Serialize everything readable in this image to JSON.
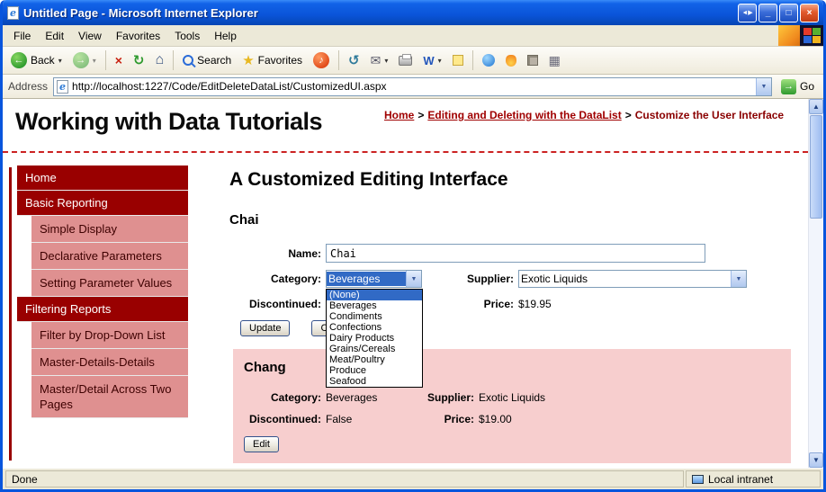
{
  "window": {
    "title": "Untitled Page - Microsoft Internet Explorer",
    "status": {
      "left": "Done",
      "right": "Local intranet"
    }
  },
  "menu_bar": {
    "items": [
      {
        "label": "File"
      },
      {
        "label": "Edit"
      },
      {
        "label": "View"
      },
      {
        "label": "Favorites"
      },
      {
        "label": "Tools"
      },
      {
        "label": "Help"
      }
    ]
  },
  "toolbar": {
    "back_label": "Back",
    "search_label": "Search",
    "favorites_label": "Favorites"
  },
  "address_bar": {
    "label": "Address",
    "url": "http://localhost:1227/Code/EditDeleteDataList/CustomizedUI.aspx",
    "go_label": "Go"
  },
  "header": {
    "title": "Working with Data Tutorials",
    "breadcrumb": {
      "home": "Home",
      "sep1": ">",
      "section": "Editing and Deleting with the DataList",
      "sep2": ">",
      "current": "Customize the User Interface"
    }
  },
  "sidebar": {
    "items": [
      {
        "label": "Home"
      },
      {
        "label": "Basic Reporting"
      },
      {
        "label": "Simple Display"
      },
      {
        "label": "Declarative Parameters"
      },
      {
        "label": "Setting Parameter Values"
      },
      {
        "label": "Filtering Reports"
      },
      {
        "label": "Filter by Drop-Down List"
      },
      {
        "label": "Master-Details-Details"
      },
      {
        "label": "Master/Detail Across Two Pages"
      }
    ]
  },
  "content": {
    "heading": "A Customized Editing Interface",
    "edit_item": {
      "title": "Chai",
      "name_label": "Name:",
      "name_value": "Chai",
      "category_label": "Category:",
      "category_value": "Beverages",
      "supplier_label": "Supplier:",
      "supplier_value": "Exotic Liquids",
      "discontinued_label": "Discontinued:",
      "price_label": "Price:",
      "price_value": "$19.95",
      "update_button": "Update",
      "cancel_button": "Cancel"
    },
    "category_dropdown": {
      "options": [
        "(None)",
        "Beverages",
        "Condiments",
        "Confections",
        "Dairy Products",
        "Grains/Cereals",
        "Meat/Poultry",
        "Produce",
        "Seafood"
      ],
      "highlighted": "(None)"
    },
    "view_item": {
      "title": "Chang",
      "category_label": "Category:",
      "category_value": "Beverages",
      "supplier_label": "Supplier:",
      "supplier_value": "Exotic Liquids",
      "discontinued_label": "Discontinued:",
      "discontinued_value": "False",
      "price_label": "Price:",
      "price_value": "$19.00",
      "edit_button": "Edit"
    }
  },
  "colors": {
    "nav_dark_red": "#990000",
    "nav_sub_pink": "#DF9090",
    "item_panel_pink": "#F7CECE",
    "selection_blue": "#316AC5",
    "titlebar_blue": "#0A54D8"
  },
  "icons": {
    "ie_logo": "e",
    "window_pair": "◄▶",
    "minimize": "_",
    "maximize": "□",
    "close": "×",
    "back_arrow": "←",
    "forward_arrow": "→",
    "stop": "×",
    "refresh": "↻",
    "home": "⌂",
    "favorites_star": "★",
    "media_note": "♪",
    "history": "↺",
    "mail": "✉",
    "word": "W",
    "grid": "▦",
    "dropdown_arrow": "▼",
    "dropdown_small": "▾",
    "scroll_up": "▲",
    "scroll_down": "▼",
    "go_arrow": "→"
  }
}
